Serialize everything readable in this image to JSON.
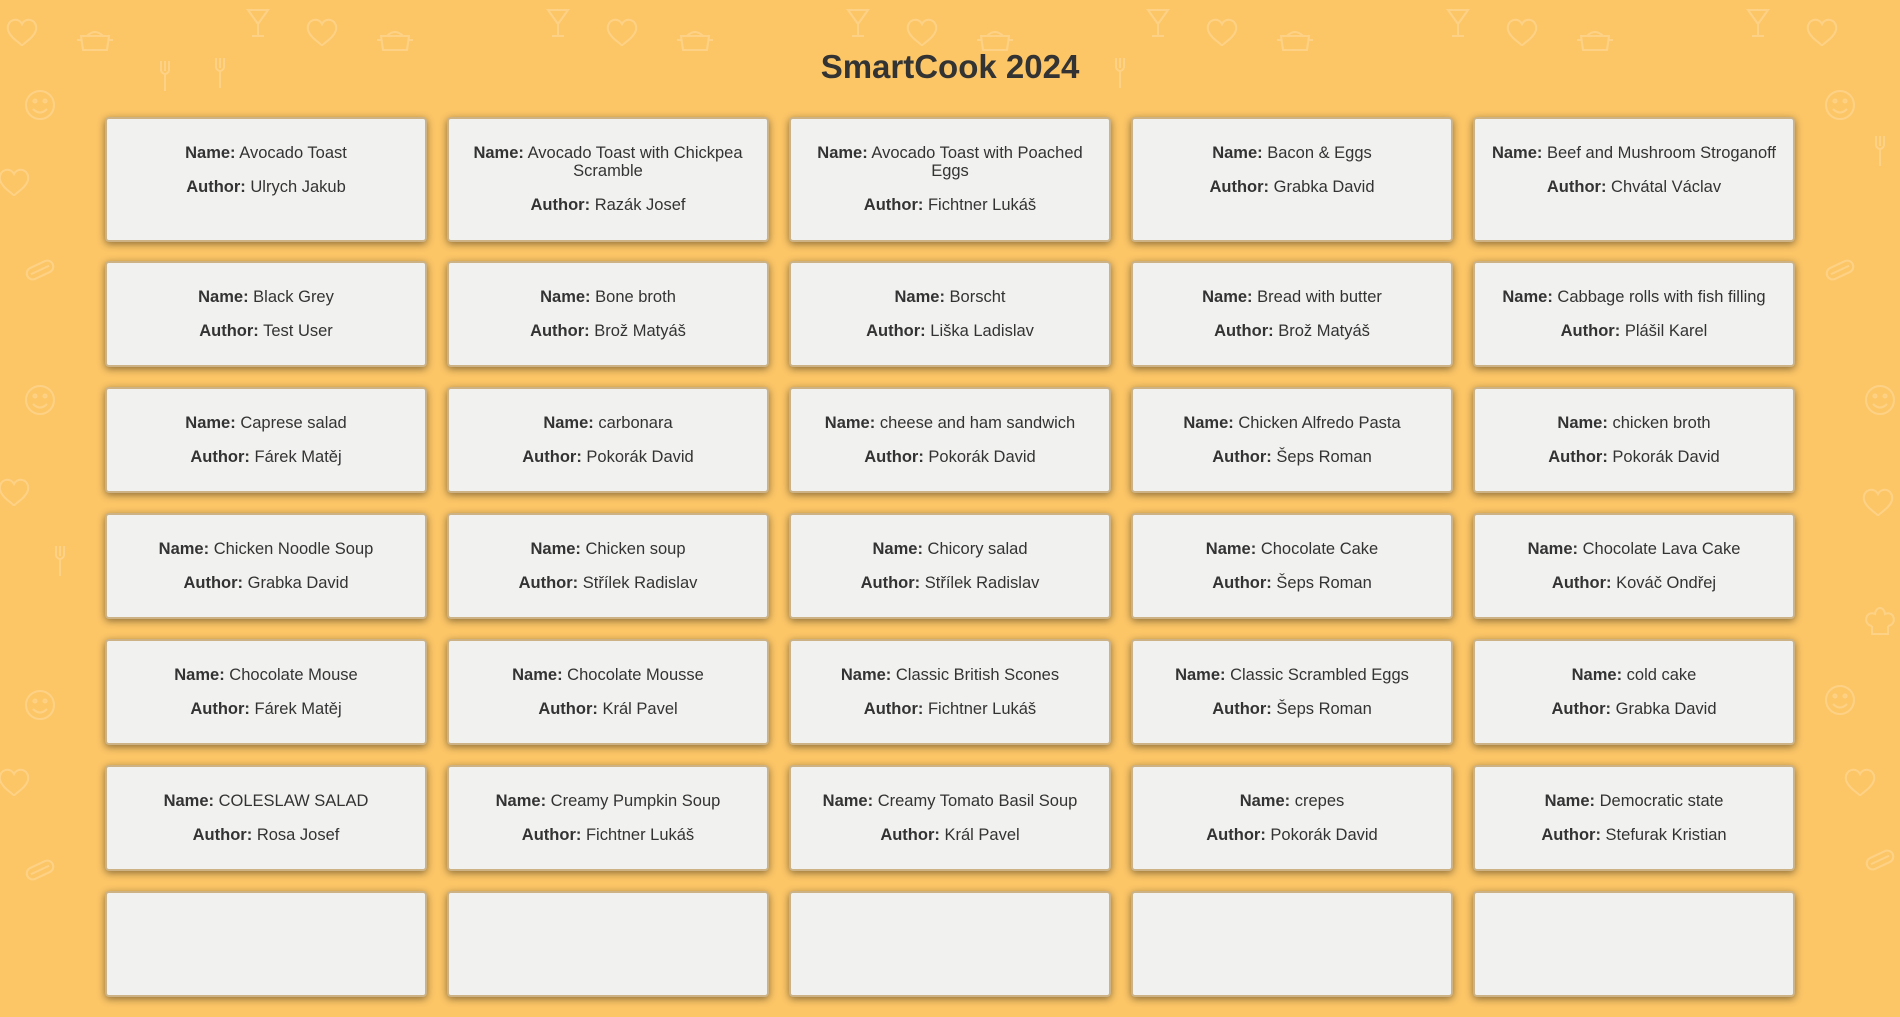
{
  "page": {
    "title": "SmartCook 2024",
    "background_color": "#fcc667",
    "card_color": "#f1f2ef"
  },
  "labels": {
    "name": "Name:",
    "author": "Author:"
  },
  "recipes": [
    {
      "name": "Avocado Toast",
      "author": "Ulrych Jakub"
    },
    {
      "name": "Avocado Toast with Chickpea Scramble",
      "author": "Razák Josef"
    },
    {
      "name": "Avocado Toast with Poached Eggs",
      "author": "Fichtner Lukáš"
    },
    {
      "name": "Bacon & Eggs",
      "author": "Grabka David"
    },
    {
      "name": "Beef and Mushroom Stroganoff",
      "author": "Chvátal Václav"
    },
    {
      "name": "Black Grey",
      "author": "Test User"
    },
    {
      "name": "Bone broth",
      "author": "Brož Matyáš"
    },
    {
      "name": "Borscht",
      "author": "Liška Ladislav"
    },
    {
      "name": "Bread with butter",
      "author": "Brož Matyáš"
    },
    {
      "name": "Cabbage rolls with fish filling",
      "author": "Plášil Karel"
    },
    {
      "name": "Caprese salad",
      "author": "Fárek Matěj"
    },
    {
      "name": "carbonara",
      "author": "Pokorák David"
    },
    {
      "name": "cheese and ham sandwich",
      "author": "Pokorák David"
    },
    {
      "name": "Chicken Alfredo Pasta",
      "author": "Šeps Roman"
    },
    {
      "name": "chicken broth",
      "author": "Pokorák David"
    },
    {
      "name": "Chicken Noodle Soup",
      "author": "Grabka David"
    },
    {
      "name": "Chicken soup",
      "author": "Střílek Radislav"
    },
    {
      "name": "Chicory salad",
      "author": "Střílek Radislav"
    },
    {
      "name": "Chocolate Cake",
      "author": "Šeps Roman"
    },
    {
      "name": "Chocolate Lava Cake",
      "author": "Kováč Ondřej"
    },
    {
      "name": "Chocolate Mouse",
      "author": "Fárek Matěj"
    },
    {
      "name": "Chocolate Mousse",
      "author": "Král Pavel"
    },
    {
      "name": "Classic British Scones",
      "author": "Fichtner Lukáš"
    },
    {
      "name": "Classic Scrambled Eggs",
      "author": "Šeps Roman"
    },
    {
      "name": "cold cake",
      "author": "Grabka David"
    },
    {
      "name": "COLESLAW SALAD",
      "author": "Rosa Josef"
    },
    {
      "name": "Creamy Pumpkin Soup",
      "author": "Fichtner Lukáš"
    },
    {
      "name": "Creamy Tomato Basil Soup",
      "author": "Král Pavel"
    },
    {
      "name": "crepes",
      "author": "Pokorák David"
    },
    {
      "name": "Democratic state",
      "author": "Stefurak Kristian"
    }
  ]
}
